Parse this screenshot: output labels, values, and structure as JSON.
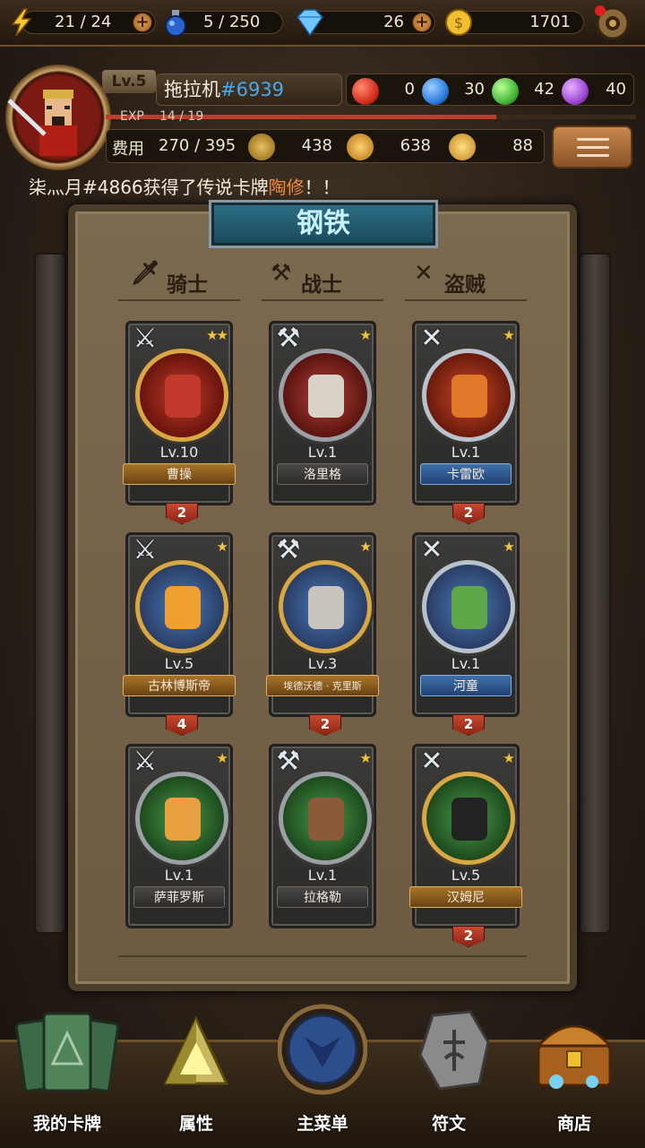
{
  "topbar": {
    "energy": "21 / 24",
    "potion": "5 / 250",
    "diamonds": "26",
    "gold": "1701",
    "icons": [
      "lightning-icon",
      "potion-icon",
      "diamond-icon",
      "coin-icon",
      "settings-icon"
    ]
  },
  "profile": {
    "level": "Lv.5",
    "name": "拖拉机",
    "tag": "#6939",
    "gems": [
      {
        "color": "#d6301e",
        "value": "0"
      },
      {
        "color": "#2f7fe0",
        "value": "30"
      },
      {
        "color": "#48b83a",
        "value": "42"
      },
      {
        "color": "#a04ad8",
        "value": "40"
      }
    ],
    "exp_label": "EXP",
    "exp_text": "14 / 19",
    "exp_fraction": 0.737,
    "cost_label": "费用",
    "cost_value": "270 / 395",
    "attack": "438",
    "defense": "638",
    "health": "88"
  },
  "ticker": {
    "prefix": "柒灬月#4866获得了传说卡牌",
    "highlight": "陶修",
    "suffix": "！！"
  },
  "board": {
    "title": "钢铁",
    "classes": [
      {
        "icon": "sword-icon",
        "glyph": "🗡",
        "label": "骑士"
      },
      {
        "icon": "axe-icon",
        "glyph": "⚒",
        "label": "战士"
      },
      {
        "icon": "crossed-blades-icon",
        "glyph": "✕",
        "label": "盗贼"
      }
    ],
    "cards": [
      {
        "name": "曹操",
        "lv": "Lv.10",
        "stars": "★★",
        "type_glyph": "⚔",
        "rarity": "gold",
        "count": "2",
        "face": "#c0392b"
      },
      {
        "name": "洛里格",
        "lv": "Lv.1",
        "stars": "★",
        "type_glyph": "⚒",
        "rarity": "grey",
        "count": "",
        "face": "#d8d2c8"
      },
      {
        "name": "卡雷欧",
        "lv": "Lv.1",
        "stars": "★",
        "type_glyph": "✕",
        "rarity": "blue",
        "count": "2",
        "face": "#e07a2a"
      },
      {
        "name": "古林博斯帝",
        "lv": "Lv.5",
        "stars": "★",
        "type_glyph": "⚔",
        "rarity": "gold",
        "count": "4",
        "face": "#f0a030"
      },
      {
        "name": "埃德沃德 · 克里斯",
        "lv": "Lv.3",
        "stars": "★",
        "type_glyph": "⚒",
        "rarity": "gold",
        "count": "2",
        "face": "#c9c4bd"
      },
      {
        "name": "河童",
        "lv": "Lv.1",
        "stars": "★",
        "type_glyph": "✕",
        "rarity": "blue",
        "count": "2",
        "face": "#5fa84a"
      },
      {
        "name": "萨菲罗斯",
        "lv": "Lv.1",
        "stars": "★",
        "type_glyph": "⚔",
        "rarity": "grey",
        "count": "",
        "face": "#e8a040"
      },
      {
        "name": "拉格勒",
        "lv": "Lv.1",
        "stars": "★",
        "type_glyph": "⚒",
        "rarity": "grey",
        "count": "",
        "face": "#8a5a3a"
      },
      {
        "name": "汉姆尼",
        "lv": "Lv.5",
        "stars": "★",
        "type_glyph": "✕",
        "rarity": "gold",
        "count": "2",
        "face": "#222222"
      }
    ]
  },
  "nav": [
    {
      "label": "我的卡牌",
      "icon": "cards-icon"
    },
    {
      "label": "属性",
      "icon": "pyramid-icon"
    },
    {
      "label": "主菜单",
      "icon": "main-emblem-icon"
    },
    {
      "label": "符文",
      "icon": "rune-stone-icon"
    },
    {
      "label": "商店",
      "icon": "treasure-chest-icon"
    }
  ]
}
